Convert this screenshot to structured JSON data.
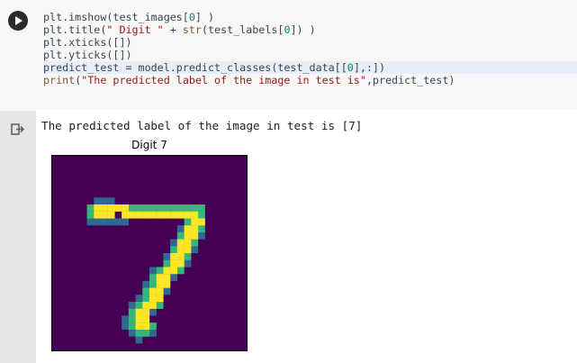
{
  "code_cell": {
    "lines": [
      [
        {
          "t": "plt.imshow(test_images[",
          "c": ""
        },
        {
          "t": "0",
          "c": "num"
        },
        {
          "t": "] )",
          "c": ""
        }
      ],
      [
        {
          "t": "plt.title(",
          "c": ""
        },
        {
          "t": "\" Digit \"",
          "c": "str"
        },
        {
          "t": " + ",
          "c": ""
        },
        {
          "t": "str",
          "c": "kw"
        },
        {
          "t": "(test_labels[",
          "c": ""
        },
        {
          "t": "0",
          "c": "num"
        },
        {
          "t": "]) )",
          "c": ""
        }
      ],
      [
        {
          "t": "plt.xticks([])",
          "c": ""
        }
      ],
      [
        {
          "t": "plt.yticks([])",
          "c": ""
        }
      ],
      [
        {
          "t": "predict_test = model.predict_classes(test_data[[",
          "c": ""
        },
        {
          "t": "0",
          "c": "num"
        },
        {
          "t": "],:])",
          "c": ""
        }
      ],
      [
        {
          "t": "print",
          "c": "kw"
        },
        {
          "t": "(",
          "c": ""
        },
        {
          "t": "\"The predicted label of the image in test is\"",
          "c": "str"
        },
        {
          "t": ",predict_test)",
          "c": ""
        }
      ]
    ]
  },
  "output": {
    "stdout": "The predicted label of the image in test is [7]",
    "figure_title": "Digit 7"
  },
  "colors": {
    "image_background": "#440154",
    "stroke_dark": "#31688e",
    "stroke_mid": "#35b779",
    "stroke_bright": "#fde725",
    "run_button": "#2b2b2b",
    "output_gutter": "#e6e6e6"
  },
  "image": {
    "grid_size": 28,
    "bright_cells": [
      [
        7,
        6
      ],
      [
        8,
        6
      ],
      [
        7,
        7
      ],
      [
        8,
        7
      ],
      [
        7,
        8
      ],
      [
        8,
        8
      ],
      [
        7,
        9
      ],
      [
        7,
        10
      ],
      [
        8,
        10
      ],
      [
        8,
        11
      ],
      [
        8,
        12
      ],
      [
        8,
        13
      ],
      [
        8,
        14
      ],
      [
        8,
        15
      ],
      [
        8,
        16
      ],
      [
        8,
        17
      ],
      [
        8,
        18
      ],
      [
        8,
        19
      ],
      [
        8,
        20
      ],
      [
        9,
        20
      ],
      [
        9,
        21
      ],
      [
        10,
        19
      ],
      [
        10,
        20
      ],
      [
        11,
        19
      ],
      [
        11,
        20
      ],
      [
        12,
        18
      ],
      [
        12,
        19
      ],
      [
        13,
        18
      ],
      [
        13,
        19
      ],
      [
        14,
        17
      ],
      [
        14,
        18
      ],
      [
        15,
        17
      ],
      [
        15,
        18
      ],
      [
        16,
        16
      ],
      [
        16,
        17
      ],
      [
        17,
        15
      ],
      [
        17,
        16
      ],
      [
        18,
        15
      ],
      [
        18,
        16
      ],
      [
        19,
        14
      ],
      [
        19,
        15
      ],
      [
        20,
        14
      ],
      [
        20,
        15
      ],
      [
        21,
        13
      ],
      [
        21,
        14
      ],
      [
        22,
        12
      ],
      [
        22,
        13
      ],
      [
        23,
        12
      ],
      [
        23,
        13
      ],
      [
        24,
        12
      ],
      [
        24,
        13
      ]
    ],
    "mid_cells": [
      [
        7,
        5
      ],
      [
        8,
        5
      ],
      [
        7,
        11
      ],
      [
        7,
        12
      ],
      [
        7,
        13
      ],
      [
        7,
        14
      ],
      [
        7,
        15
      ],
      [
        7,
        16
      ],
      [
        7,
        17
      ],
      [
        7,
        18
      ],
      [
        7,
        19
      ],
      [
        7,
        20
      ],
      [
        7,
        21
      ],
      [
        8,
        21
      ],
      [
        9,
        19
      ],
      [
        10,
        21
      ],
      [
        11,
        18
      ],
      [
        12,
        20
      ],
      [
        13,
        17
      ],
      [
        14,
        19
      ],
      [
        15,
        16
      ],
      [
        16,
        15
      ],
      [
        16,
        18
      ],
      [
        17,
        14
      ],
      [
        18,
        14
      ],
      [
        19,
        13
      ],
      [
        20,
        13
      ],
      [
        21,
        12
      ],
      [
        21,
        15
      ],
      [
        22,
        11
      ],
      [
        23,
        11
      ],
      [
        24,
        11
      ],
      [
        24,
        14
      ],
      [
        25,
        12
      ],
      [
        25,
        13
      ]
    ],
    "dark_cells": [
      [
        6,
        6
      ],
      [
        6,
        7
      ],
      [
        6,
        8
      ],
      [
        9,
        5
      ],
      [
        9,
        6
      ],
      [
        9,
        7
      ],
      [
        9,
        8
      ],
      [
        9,
        9
      ],
      [
        9,
        10
      ],
      [
        10,
        18
      ],
      [
        11,
        21
      ],
      [
        12,
        17
      ],
      [
        13,
        20
      ],
      [
        14,
        16
      ],
      [
        15,
        19
      ],
      [
        16,
        14
      ],
      [
        17,
        17
      ],
      [
        18,
        13
      ],
      [
        19,
        16
      ],
      [
        20,
        12
      ],
      [
        21,
        11
      ],
      [
        22,
        14
      ],
      [
        23,
        10
      ],
      [
        24,
        10
      ],
      [
        25,
        11
      ],
      [
        25,
        14
      ],
      [
        26,
        12
      ]
    ]
  }
}
